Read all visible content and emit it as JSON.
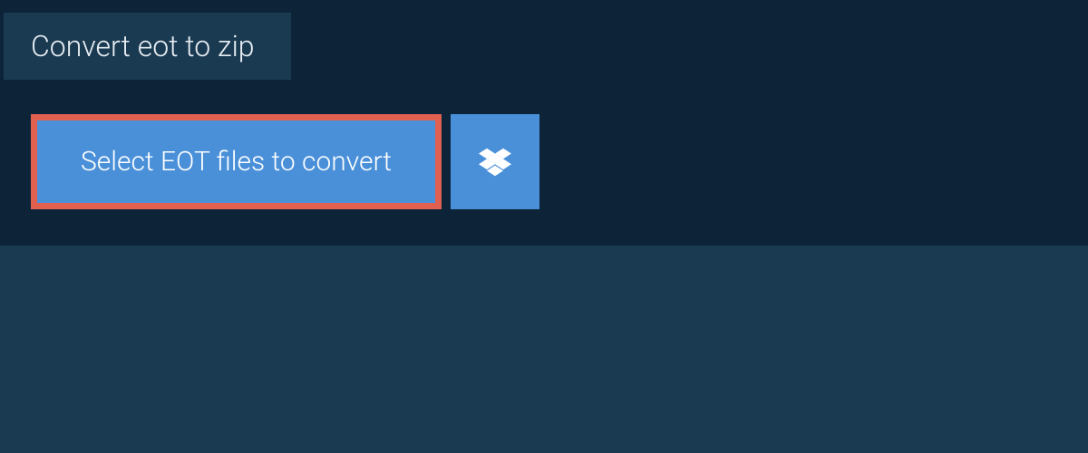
{
  "tab": {
    "title": "Convert eot to zip"
  },
  "actions": {
    "select_label": "Select EOT files to convert"
  }
}
